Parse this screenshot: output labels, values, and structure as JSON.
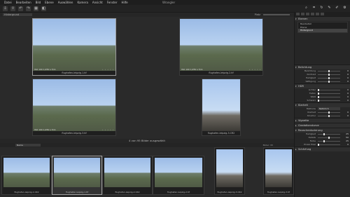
{
  "app": {
    "title": "Wrangler"
  },
  "menu": [
    "Datei",
    "Bearbeiten",
    "Bild",
    "Ebene",
    "Auswählen",
    "Kamera",
    "Ansicht",
    "Fenster",
    "Hilfe"
  ],
  "toolbar": {
    "icons": [
      "import-icon",
      "export-icon",
      "undo-icon",
      "redo-icon",
      "grid-icon",
      "compare-icon"
    ],
    "right_icons": [
      "zoom-icon",
      "crop-icon",
      "rotate-icon",
      "picker-icon",
      "brush-icon",
      "settings-icon"
    ]
  },
  "viewer": {
    "search_value": "Hintergrund",
    "zoom_label": "Platz",
    "thumbs": [
      {
        "meta": "ISO 100  1/250 s  f/11",
        "caption": "flughafen-leipzig-1.tif",
        "rating": "• • • • •"
      },
      {
        "meta": "ISO 100  1/250 s  f/11",
        "caption": "flughafen-leipzig-2.tif",
        "rating": "• • • • •"
      },
      {
        "meta": "ISO 100  1/250 s  f/11",
        "caption": "flughafen-leipzig-3.tif",
        "rating": "• • • • •"
      },
      {
        "meta": "",
        "caption": "flughafen-leipzig-3.CR2",
        "rating": ""
      }
    ],
    "status": "4 von 95 Bilder ausgewählt"
  },
  "filmstrip": {
    "label": "Name",
    "count": "Bilder: 95",
    "items": [
      {
        "caption": "flughafen-leipzig-1.CR2"
      },
      {
        "caption": "flughafen-leipzig-1.tif"
      },
      {
        "caption": "flughafen-leipzig-2.CR2"
      },
      {
        "caption": "flughafen-leipzig-2.tif"
      },
      {
        "caption": "flughafen-leipzig-3.CR2"
      },
      {
        "caption": "flughafen-leipzig-3.tif"
      }
    ]
  },
  "inspector": {
    "layers_title": "Ebenen",
    "layers": [
      "Bearbeitet",
      "Ebene",
      "Hintergrund"
    ],
    "exposure_title": "Belichtung",
    "exposure": [
      {
        "label": "Belichtung",
        "value": "0"
      },
      {
        "label": "Kontrast",
        "value": "0"
      },
      {
        "label": "Helligkeit",
        "value": "0"
      },
      {
        "label": "Sättigung",
        "value": "0"
      }
    ],
    "hdr_title": "HDR",
    "hdr": [
      {
        "label": "Lichter",
        "value": "0"
      },
      {
        "label": "Tiefen",
        "value": "0"
      },
      {
        "label": "Weiß",
        "value": "0"
      },
      {
        "label": "Schwarz",
        "value": "0"
      }
    ],
    "clarity_title": "Klarheit",
    "clarity_method_label": "Methode",
    "clarity_method_value": "Natürlich",
    "clarity": [
      {
        "label": "Klarheit",
        "value": "0"
      },
      {
        "label": "Struktur",
        "value": "0"
      }
    ],
    "vignette_title": "Vignette",
    "levels_title": "Gradationskurve",
    "noise_title": "Rauschreduzierung",
    "noise": [
      {
        "label": "Helligkeit",
        "value": "25"
      },
      {
        "label": "Details",
        "value": "50"
      },
      {
        "label": "Farbe",
        "value": "25"
      },
      {
        "label": "Einzel Pixel",
        "value": "0"
      }
    ],
    "sharpen_title": "Schärfung"
  }
}
